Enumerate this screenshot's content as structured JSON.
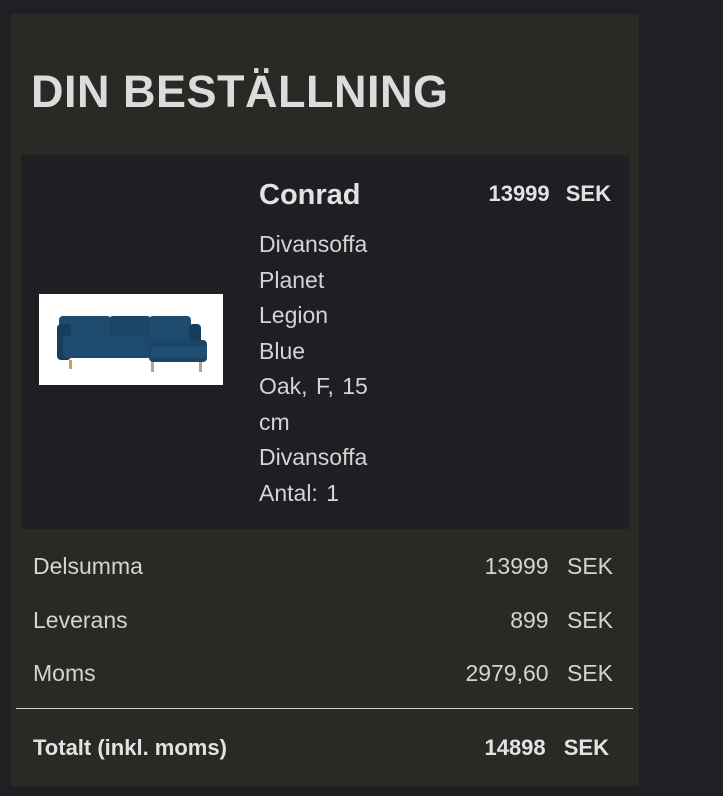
{
  "order": {
    "heading": "DIN BESTÄLLNING",
    "item": {
      "name": "Conrad",
      "price": "13999 SEK",
      "attributes": [
        "Divansoffa",
        "Planet",
        "Legion",
        "Blue",
        "Oak, F, 15",
        "cm",
        "Divansoffa",
        "Antal: 1"
      ],
      "image_icon": "sofa-image"
    },
    "summary": {
      "subtotal_label": "Delsumma",
      "subtotal_value": "13999 SEK",
      "delivery_label": "Leverans",
      "delivery_value": "899 SEK",
      "vat_label": "Moms",
      "vat_value": "2979,60 SEK"
    },
    "total": {
      "label": "Totalt (inkl. moms)",
      "value": "14898 SEK"
    }
  },
  "colors": {
    "page_bg": "#1f2024",
    "panel_bg": "#2a2925",
    "card_bg": "#1e1f23",
    "sofa": "#1d4a6e",
    "text": "#d8d8d8"
  }
}
